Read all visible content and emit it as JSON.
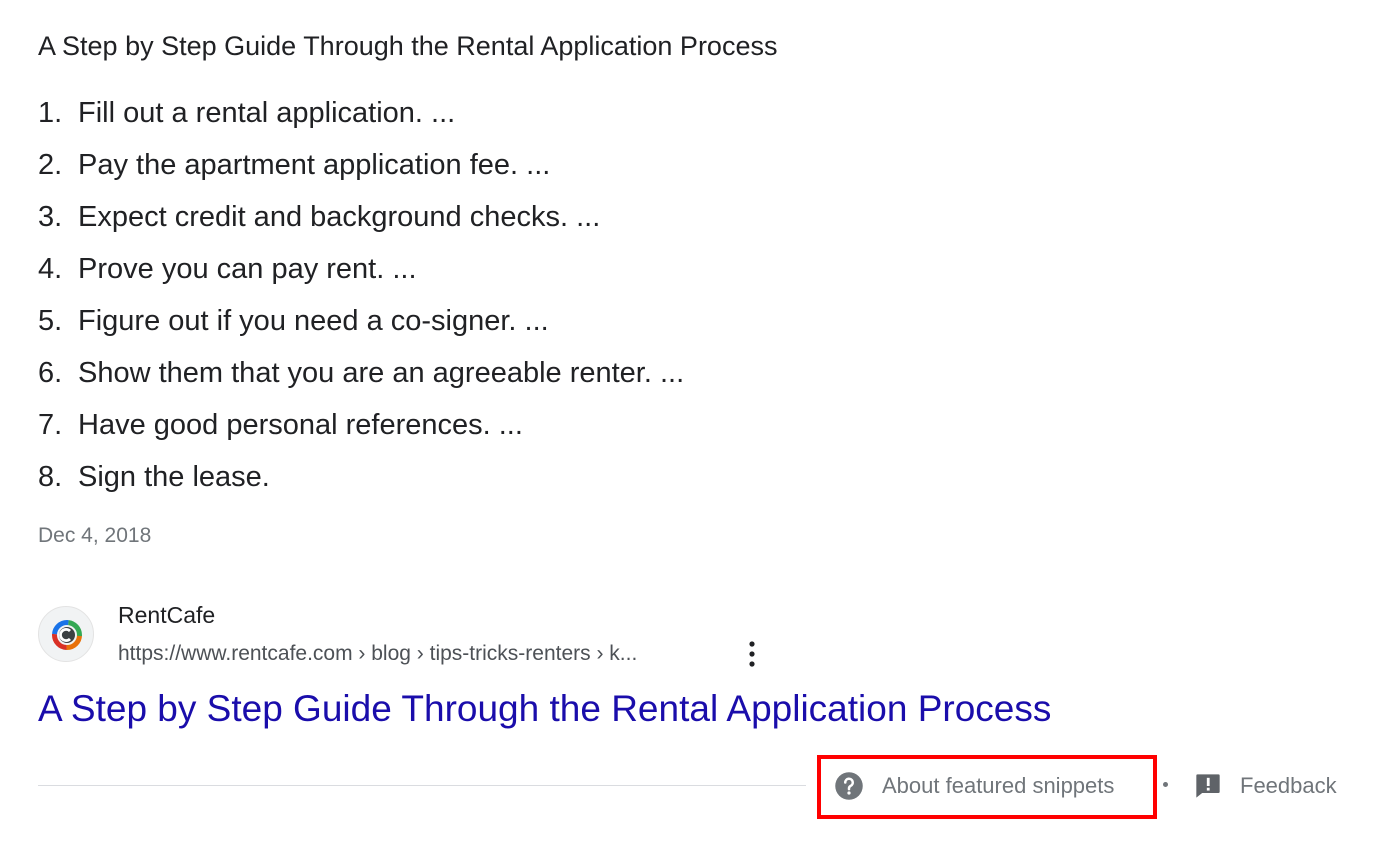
{
  "snippet": {
    "heading": "A Step by Step Guide Through the Rental Application Process",
    "steps": [
      {
        "num": "1.",
        "text": "Fill out a rental application. ..."
      },
      {
        "num": "2.",
        "text": "Pay the apartment application fee. ..."
      },
      {
        "num": "3.",
        "text": "Expect credit and background checks. ..."
      },
      {
        "num": "4.",
        "text": "Prove you can pay rent. ..."
      },
      {
        "num": "5.",
        "text": "Figure out if you need a co-signer. ..."
      },
      {
        "num": "6.",
        "text": "Show them that you are an agreeable renter. ..."
      },
      {
        "num": "7.",
        "text": "Have good personal references. ..."
      },
      {
        "num": "8.",
        "text": "Sign the lease."
      }
    ],
    "date": "Dec 4, 2018"
  },
  "source": {
    "favicon_icon": "rentcafe-logo-icon",
    "site_name": "RentCafe",
    "url": "https://www.rentcafe.com › blog › tips-tricks-renters › k...",
    "menu_icon": "more-vert-icon",
    "title": "A Step by Step Guide Through the Rental Application Process",
    "title_color": "#1a0dab"
  },
  "footer": {
    "about_icon": "help-circle-icon",
    "about_label": "About featured snippets",
    "feedback_icon": "feedback-icon",
    "feedback_label": "Feedback",
    "highlight_color": "#ff0000"
  }
}
